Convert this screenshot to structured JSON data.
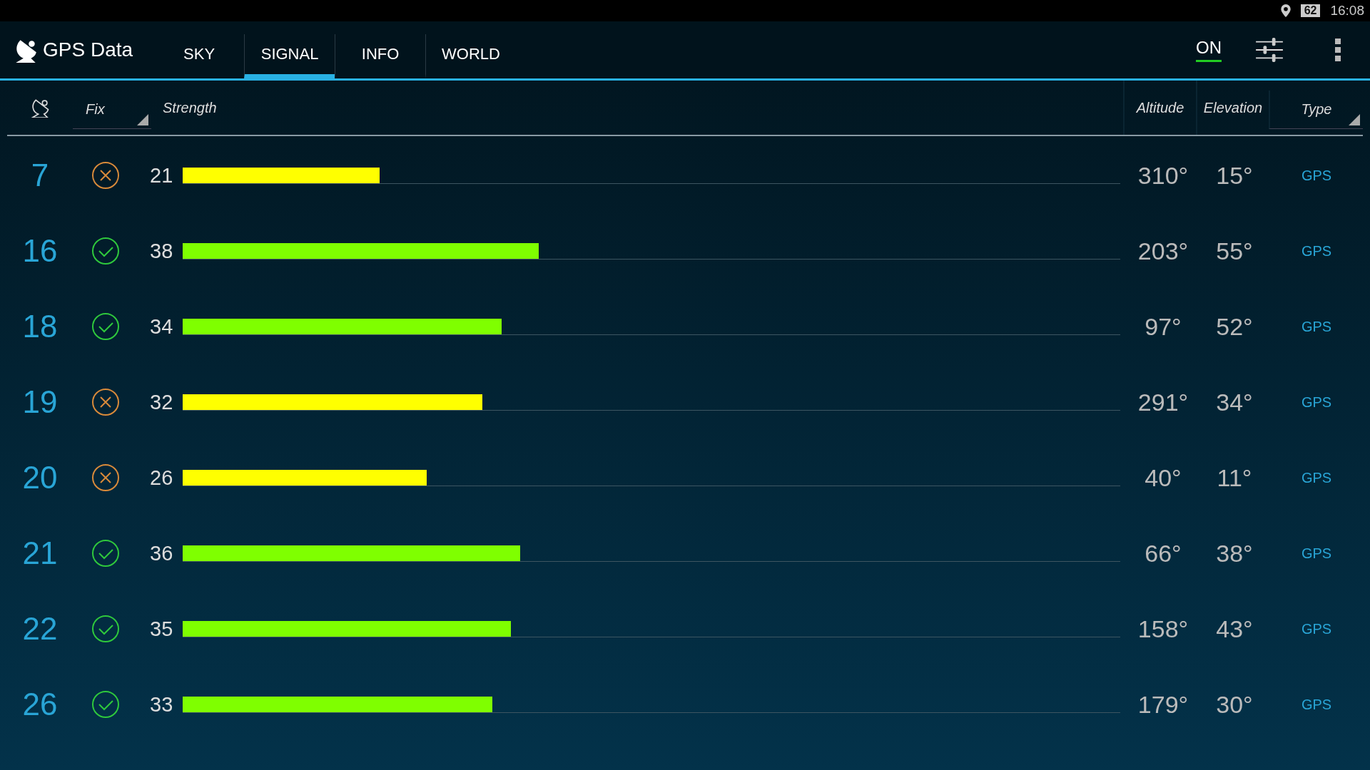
{
  "status_bar": {
    "battery": "62",
    "time": "16:08"
  },
  "app_bar": {
    "title": "GPS Data",
    "tabs": [
      {
        "label": "SKY",
        "selected": false
      },
      {
        "label": "SIGNAL",
        "selected": true
      },
      {
        "label": "INFO",
        "selected": false
      },
      {
        "label": "WORLD",
        "selected": false
      }
    ],
    "toggle": {
      "label": "ON",
      "on": true
    }
  },
  "table": {
    "columns": [
      "Fix",
      "Strength",
      "Altitude",
      "Elevation",
      "Type"
    ],
    "rows": [
      {
        "id": "7",
        "fixed": false,
        "strength": "21",
        "level": 0.21,
        "altitude": "310°",
        "elevation": "15°",
        "type": "GPS"
      },
      {
        "id": "16",
        "fixed": true,
        "strength": "38",
        "level": 0.38,
        "altitude": "203°",
        "elevation": "55°",
        "type": "GPS"
      },
      {
        "id": "18",
        "fixed": true,
        "strength": "34",
        "level": 0.34,
        "altitude": "97°",
        "elevation": "52°",
        "type": "GPS"
      },
      {
        "id": "19",
        "fixed": false,
        "strength": "32",
        "level": 0.32,
        "altitude": "291°",
        "elevation": "34°",
        "type": "GPS"
      },
      {
        "id": "20",
        "fixed": false,
        "strength": "26",
        "level": 0.26,
        "altitude": "40°",
        "elevation": "11°",
        "type": "GPS"
      },
      {
        "id": "21",
        "fixed": true,
        "strength": "36",
        "level": 0.36,
        "altitude": "66°",
        "elevation": "38°",
        "type": "GPS"
      },
      {
        "id": "22",
        "fixed": true,
        "strength": "35",
        "level": 0.35,
        "altitude": "158°",
        "elevation": "43°",
        "type": "GPS"
      },
      {
        "id": "26",
        "fixed": true,
        "strength": "33",
        "level": 0.33,
        "altitude": "179°",
        "elevation": "30°",
        "type": "GPS"
      }
    ]
  }
}
